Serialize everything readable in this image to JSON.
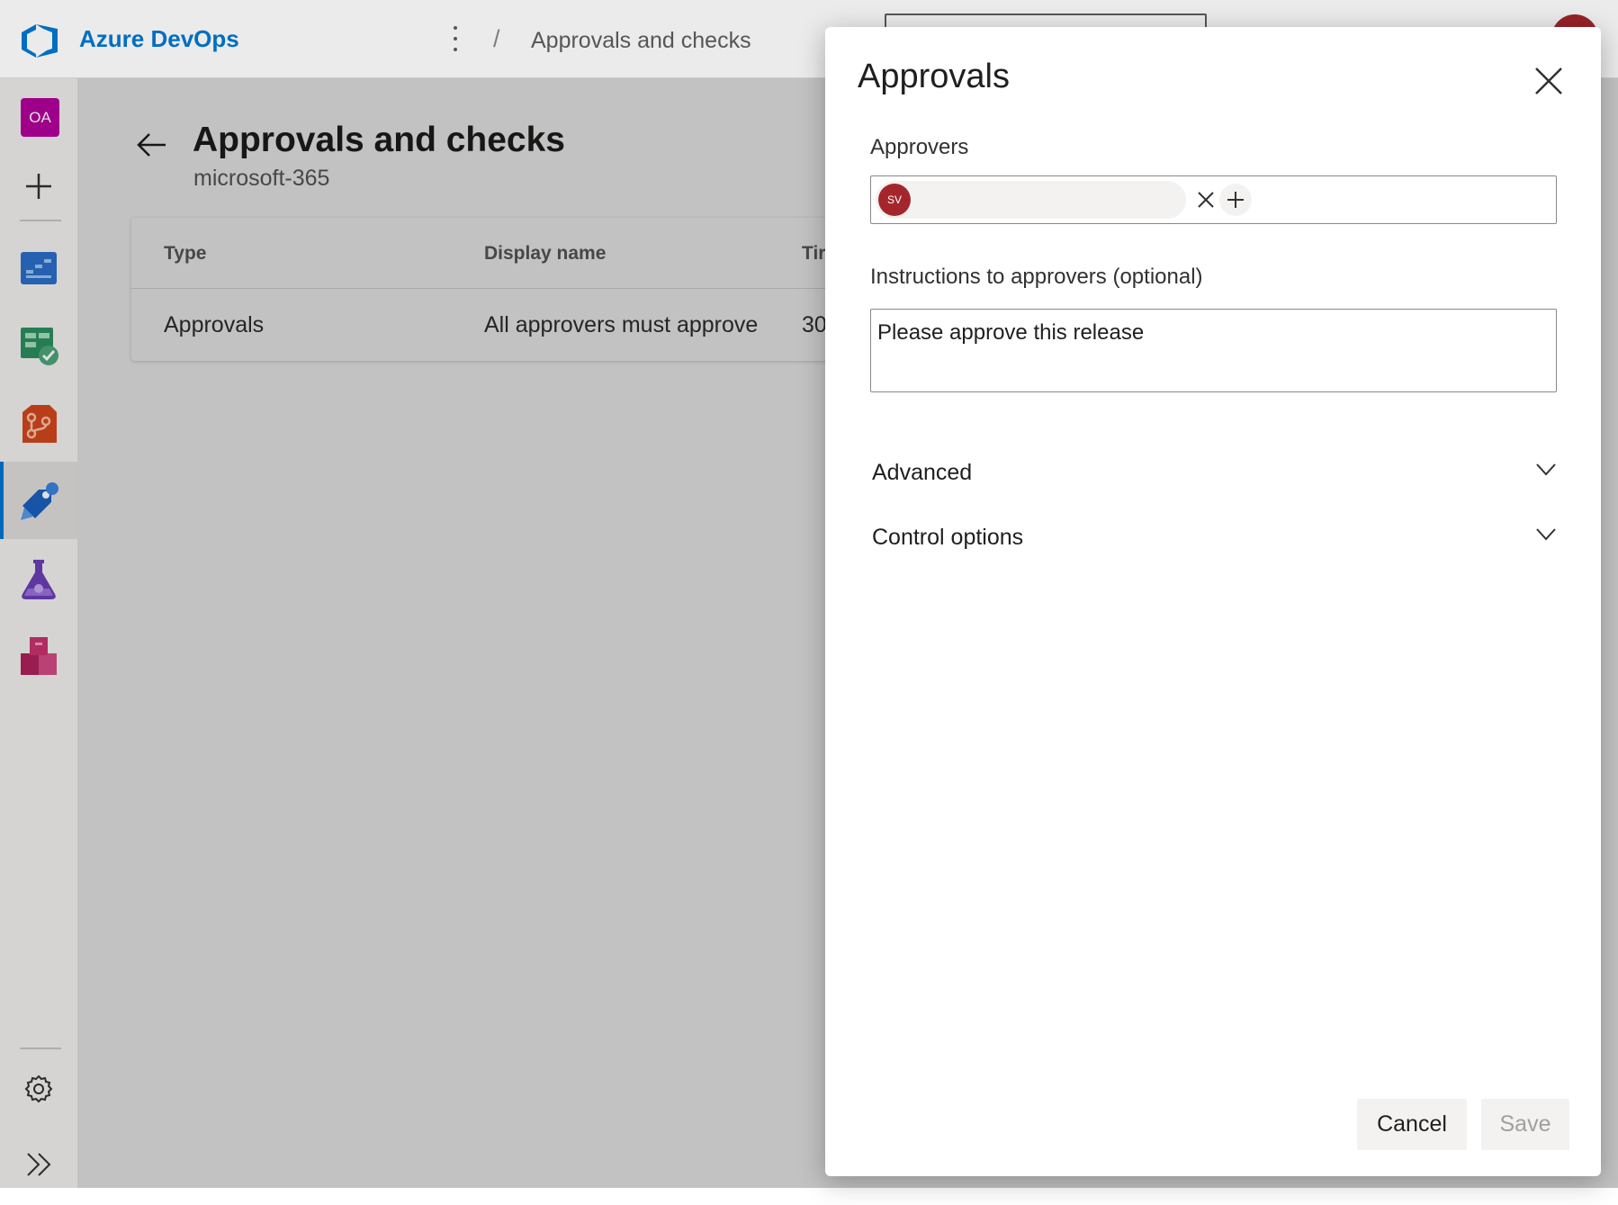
{
  "header": {
    "brand": "Azure DevOps",
    "breadcrumb_separator": "/",
    "breadcrumb": "Approvals and checks"
  },
  "rail": {
    "org_initials": "OA",
    "items": [
      "new-project-icon",
      "boards-icon",
      "test-plans-icon",
      "repos-icon",
      "pipelines-icon",
      "test-icon",
      "artifacts-icon",
      "settings-icon",
      "expand-icon"
    ]
  },
  "main": {
    "title": "Approvals and checks",
    "subtitle": "microsoft-365",
    "columns": [
      "Type",
      "Display name",
      "Tir"
    ],
    "rows": [
      [
        "Approvals",
        "All approvers must approve",
        "30"
      ]
    ]
  },
  "panel": {
    "title": "Approvals",
    "approvers_label": "Approvers",
    "approver_initials": "SV",
    "instructions_label": "Instructions to approvers (optional)",
    "instructions_value": "Please approve this release",
    "sections": [
      "Advanced",
      "Control options"
    ],
    "cancel_label": "Cancel",
    "save_label": "Save"
  },
  "colors": {
    "accent": "#0078d4",
    "avatar": "#a4262c",
    "org_badge": "#b4009e"
  }
}
